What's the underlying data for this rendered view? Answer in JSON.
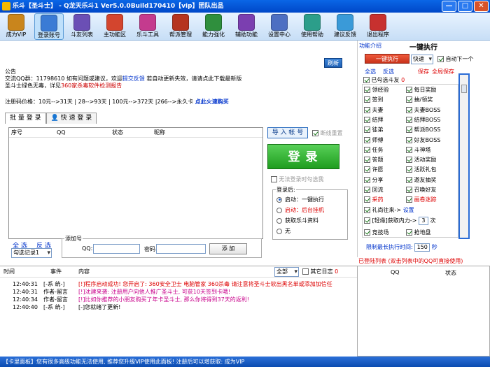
{
  "title": "乐斗【圣斗士】 - Q龙天乐斗1 Ver5.0.0Build170410【vip】团队出品",
  "window": {
    "min": "—",
    "max": "□",
    "close": "✕"
  },
  "toolbar": [
    {
      "label": "成为VIP",
      "color": "#c9851c"
    },
    {
      "label": "登录账号",
      "color": "#3a7bd5"
    },
    {
      "label": "斗友列表",
      "color": "#6b4fb5"
    },
    {
      "label": "主功能区",
      "color": "#d3452e"
    },
    {
      "label": "乐斗工具",
      "color": "#c43b8e"
    },
    {
      "label": "帮派管理",
      "color": "#b5341f"
    },
    {
      "label": "能力强化",
      "color": "#2f8f3d"
    },
    {
      "label": "辅助功能",
      "color": "#7b3fb0"
    },
    {
      "label": "设置中心",
      "color": "#4d6fc2"
    },
    {
      "label": "使用帮助",
      "color": "#2c9e8a"
    },
    {
      "label": "建议反馈",
      "color": "#3a9ad8"
    },
    {
      "label": "退出程序",
      "color": "#c7312f"
    }
  ],
  "notice": {
    "refresh": "刷新",
    "title": "公告",
    "line1a": "交流QQ群：11798610   如有问题或建议，欢迎",
    "line1b": "提交反馈",
    "line1c": "   若自动更新失效，请请点此下载最新版",
    "line2a": "圣斗士绿色无毒，详见",
    "line2b": "360家杀毒软件检测报告",
    "reg_prefix": "注册码价格：10元-->31天  | 28-->93天  | 100元-->372天  |266-->永久卡",
    "reg_link": "点此火速购买"
  },
  "tabs": [
    "批 量 登 录",
    "快 速 登 录"
  ],
  "list": {
    "headers": [
      "序号",
      "QQ",
      "状态",
      "昵称"
    ]
  },
  "import_btn": "导 入 帐 号",
  "recover_label": "断线重置",
  "login_btn": "登录",
  "no_login_hint": "无法登录时勾选我",
  "after_login": {
    "caption": "登录后:",
    "options": [
      "启动：一键执行",
      "启动：后台挂机",
      "获取乐斗资料",
      "无"
    ]
  },
  "select": {
    "all": "全 选",
    "invert": "反 选",
    "record": "勾选记录1"
  },
  "add_qq": {
    "caption": "添加号",
    "qq_label": "QQ:",
    "pwd_label": "密码:",
    "add_btn": "添 加"
  },
  "right": {
    "intro": "功能介绍",
    "title": "一键执行",
    "exec_btn": "一键执行",
    "speed": "快速",
    "next_label": "自动下一个",
    "select_all": "全选",
    "invert": "反选",
    "save": "保存",
    "save_all": "全局保存",
    "friends_label": "已勾选斗友",
    "friends_count": "0",
    "tasks_left": [
      "领经验",
      "签到",
      "夫妻",
      "结拜",
      "徒弟",
      "师傅",
      "任务",
      "答题",
      "许愿",
      "分享",
      "回流",
      "采药"
    ],
    "tasks_right": [
      "每日奖励",
      "抽/领奖",
      "夫妻BOSS",
      "结拜BOSS",
      "帮派BOSS",
      "好友BOSS",
      "斗神塔",
      "活动奖励",
      "活跃礼包",
      "邀友抽奖",
      "召唤好友",
      "画卷迷踪"
    ],
    "gift": "礼尚往来->",
    "gift_link": "设置",
    "light": "[轻缘]获取内力->",
    "light_val": "3",
    "light_unit": "次",
    "more_left": "竞技场",
    "more_right": "抢地盘",
    "limit_label": "限制最长执行时间:",
    "limit_val": "150",
    "limit_unit": "秒"
  },
  "logged": {
    "label": "已登陆列表",
    "hint": "(双击列表中的QQ可直接使用)",
    "headers": [
      "QQ",
      "状态"
    ]
  },
  "log": {
    "headers": [
      "时间",
      "事件",
      "内容"
    ],
    "filter": "全部",
    "other_log": "其它日志",
    "other_count": "0",
    "rows": [
      {
        "time": "12:40:31",
        "event": "[-系 统-]",
        "text": "[!]程序启动成功! 您开启了: 360安全卫士 电脑管家 360杀毒 请注意将圣斗士软出黑名单或添加加信任",
        "color": "#d00"
      },
      {
        "time": "12:40:31",
        "event": "作者-留言",
        "text": "[!]沈建来袭: 注册用户向他人推广圣斗士, 可获10天签到卡哦!",
        "color": "#c8008a"
      },
      {
        "time": "12:40:34",
        "event": "作者-留言",
        "text": "[!]比如你推荐的小朋友购买了年卡圣斗士, 那么你将得到37天的返利!",
        "color": "#c8008a"
      },
      {
        "time": "12:40:40",
        "event": "[-系 统-]",
        "text": "[-]您就绪了更新!",
        "color": "#000"
      }
    ]
  },
  "status": "【卡里面板】您有很多高级功能无法使用, 推荐您升级VIP使用此面板!    注册后可以增获取: 成为VIP"
}
